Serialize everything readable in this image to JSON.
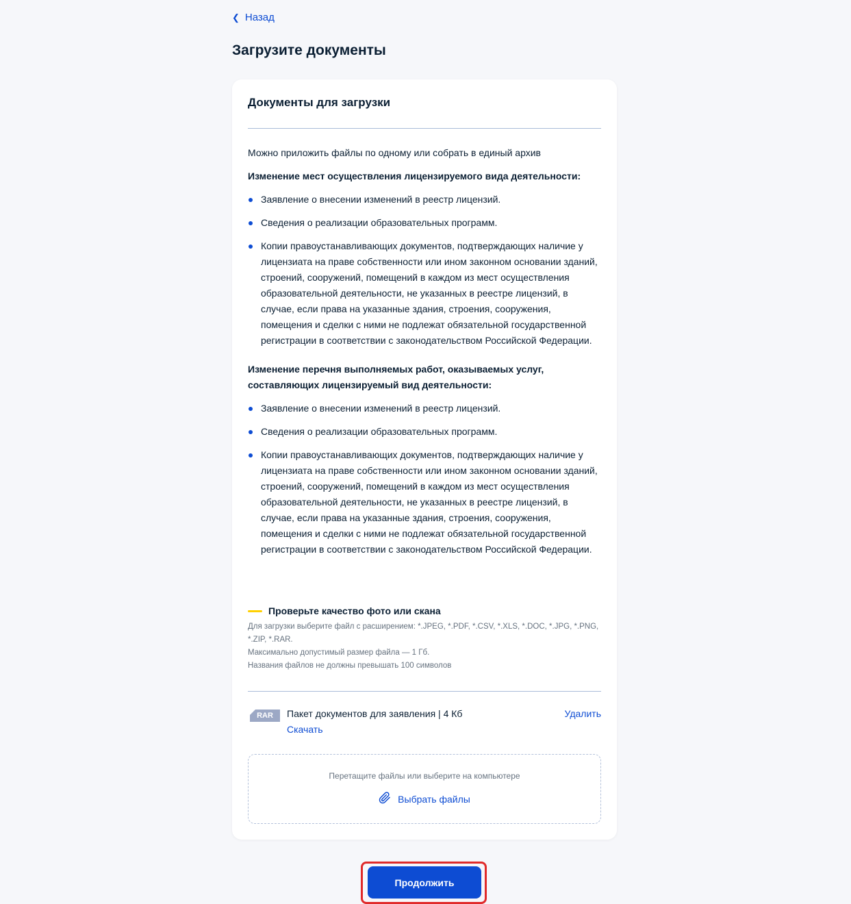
{
  "nav": {
    "back_label": "Назад"
  },
  "page": {
    "title": "Загрузите документы"
  },
  "card": {
    "title": "Документы для загрузки",
    "intro": "Можно приложить файлы по одному или собрать в единый архив",
    "sections": [
      {
        "heading": "Изменение мест осуществления лицензируемого вида деятельности:",
        "items": [
          "Заявление о внесении изменений в реестр лицензий.",
          "Сведения о реализации образовательных программ.",
          "Копии правоустанавливающих документов, подтверждающих наличие у лицензиата на праве собственности или ином законном основании зданий, строений, сооружений, помещений в каждом из мест осуществления образовательной деятельности, не указанных в реестре лицензий, в случае, если права на указанные здания, строения, сооружения, помещения и сделки с ними не подлежат обязательной государственной регистрации в соответствии с законодательством Российской Федерации."
        ]
      },
      {
        "heading": "Изменение перечня выполняемых работ, оказываемых услуг, составляющих лицензируемый вид деятельности:",
        "items": [
          "Заявление о внесении изменений в реестр лицензий.",
          "Сведения о реализации образовательных программ.",
          "Копии правоустанавливающих документов, подтверждающих наличие у лицензиата на праве собственности или ином законном основании зданий, строений, сооружений, помещений в каждом из мест осуществления образовательной деятельности, не указанных в реестре лицензий, в случае, если права на указанные здания, строения, сооружения, помещения и сделки с ними не подлежат обязательной государственной регистрации в соответствии с законодательством Российской Федерации."
        ]
      }
    ],
    "quality": {
      "heading": "Проверьте качество фото или скана",
      "formats": "Для загрузки выберите файл с расширением: *.JPEG, *.PDF, *.CSV, *.XLS, *.DOC, *.JPG, *.PNG, *.ZIP, *.RAR.",
      "max_size": "Максимально допустимый размер файла — 1 Гб.",
      "name_limit": "Названия файлов не должны превышать 100 символов"
    },
    "file": {
      "badge": "RAR",
      "name": "Пакет документов для заявления",
      "separator": "|",
      "size": "4 Кб",
      "download_label": "Скачать",
      "delete_label": "Удалить"
    },
    "dropzone": {
      "hint": "Перетащите файлы или выберите на компьютере",
      "choose_label": "Выбрать файлы"
    }
  },
  "footer": {
    "continue_label": "Продолжить"
  },
  "colors": {
    "accent": "#0d4cd3",
    "highlight": "#e02a2a",
    "warning_bar": "#ffd000"
  }
}
